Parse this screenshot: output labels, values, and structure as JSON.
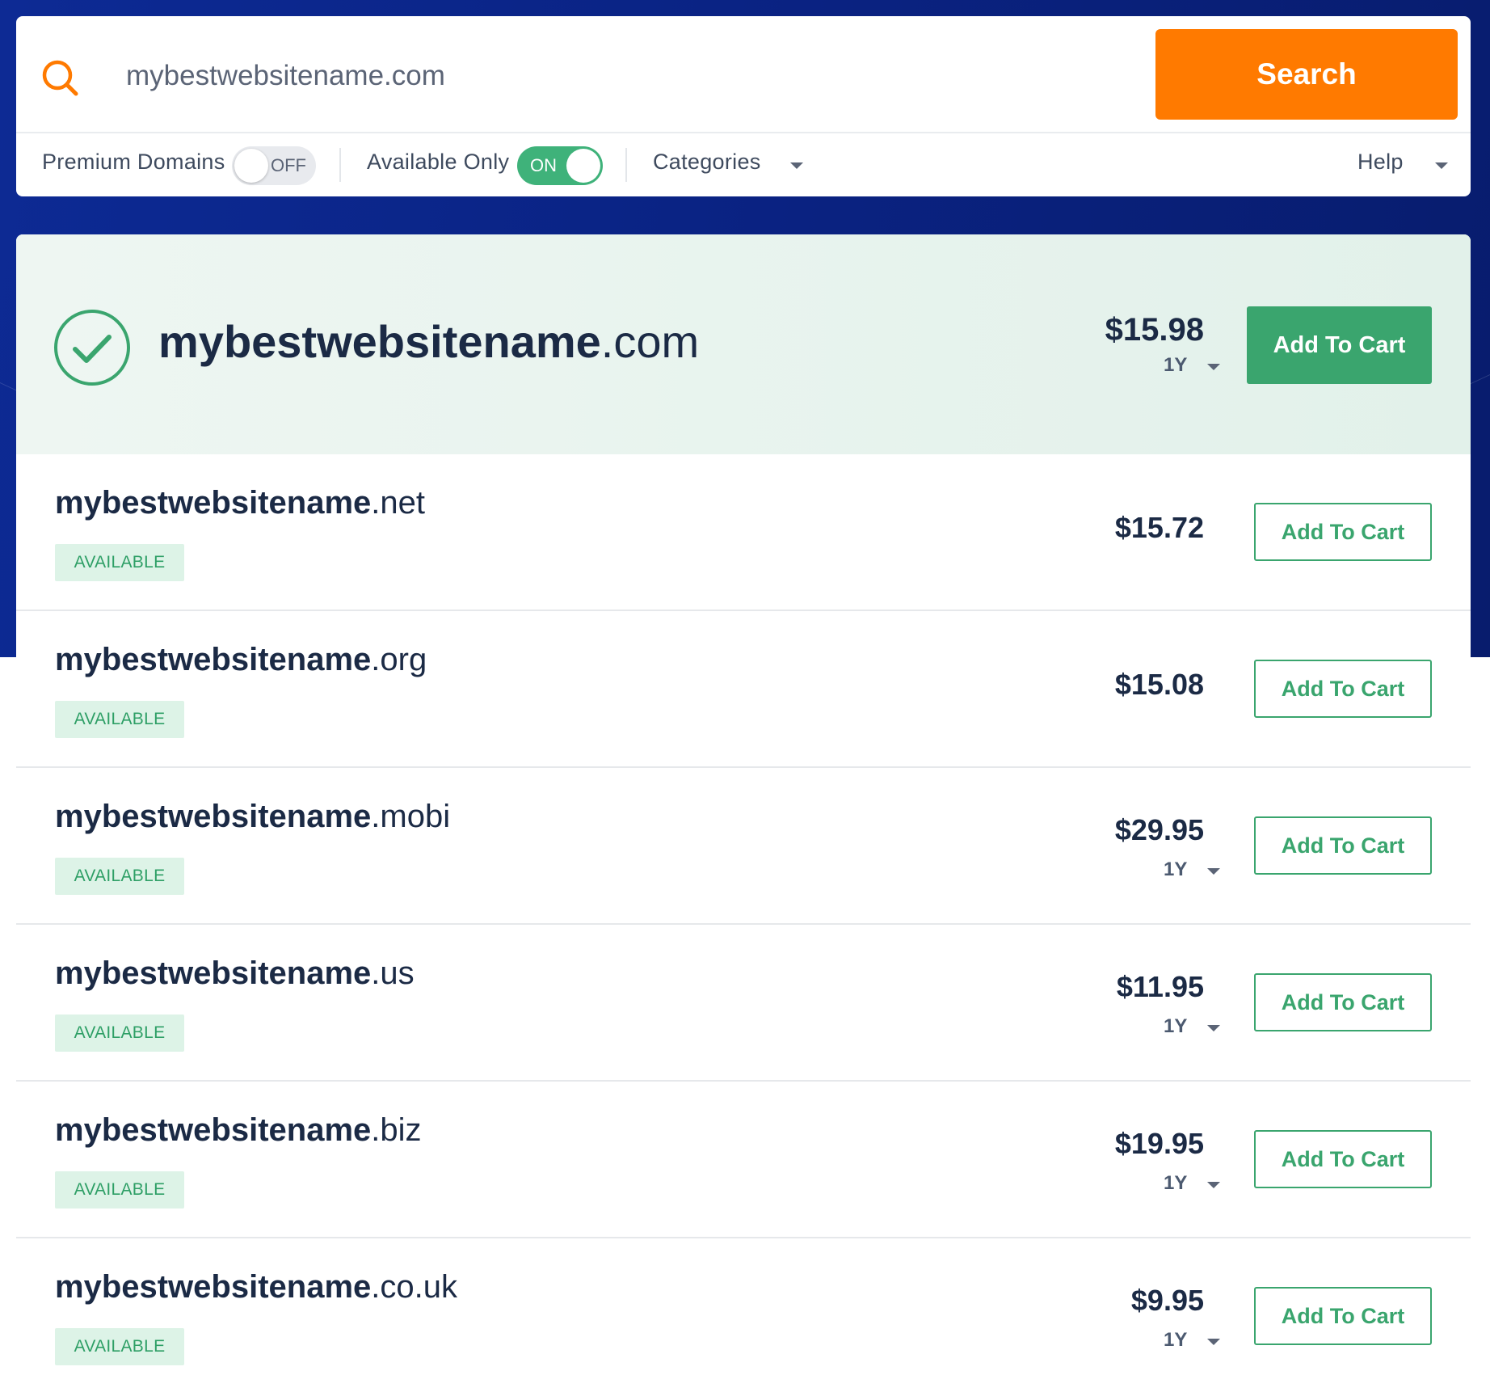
{
  "search": {
    "query": "mybestwebsitename.com",
    "button_label": "Search"
  },
  "filters": {
    "premium": {
      "label": "Premium Domains",
      "state": "OFF"
    },
    "available_only": {
      "label": "Available Only",
      "state": "ON"
    },
    "categories_label": "Categories",
    "help_label": "Help"
  },
  "featured": {
    "name": "mybestwebsitename",
    "tld": ".com",
    "price": "$15.98",
    "term": "1Y",
    "cart_label": "Add To Cart"
  },
  "results": [
    {
      "name": "mybestwebsitename",
      "tld": ".net",
      "status": "AVAILABLE",
      "price": "$15.72",
      "term": "",
      "cart_label": "Add To Cart"
    },
    {
      "name": "mybestwebsitename",
      "tld": ".org",
      "status": "AVAILABLE",
      "price": "$15.08",
      "term": "",
      "cart_label": "Add To Cart"
    },
    {
      "name": "mybestwebsitename",
      "tld": ".mobi",
      "status": "AVAILABLE",
      "price": "$29.95",
      "term": "1Y",
      "cart_label": "Add To Cart"
    },
    {
      "name": "mybestwebsitename",
      "tld": ".us",
      "status": "AVAILABLE",
      "price": "$11.95",
      "term": "1Y",
      "cart_label": "Add To Cart"
    },
    {
      "name": "mybestwebsitename",
      "tld": ".biz",
      "status": "AVAILABLE",
      "price": "$19.95",
      "term": "1Y",
      "cart_label": "Add To Cart"
    },
    {
      "name": "mybestwebsitename",
      "tld": ".co.uk",
      "status": "AVAILABLE",
      "price": "$9.95",
      "term": "1Y",
      "cart_label": "Add To Cart"
    }
  ],
  "colors": {
    "header_bg": "#0a2384",
    "search_button": "#ff7a00",
    "accent_green": "#3aa56e",
    "toggle_on": "#3fb27a",
    "badge_bg": "#ddf3e7"
  },
  "icons": {
    "search": "search-icon",
    "available": "check-circle-icon",
    "dropdown": "caret-down-icon"
  }
}
